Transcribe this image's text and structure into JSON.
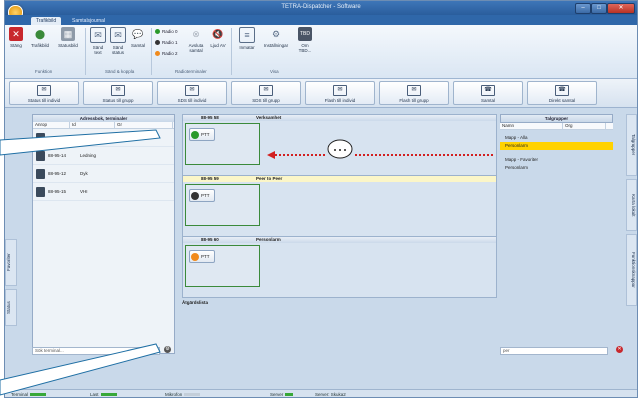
{
  "window": {
    "title": "TETRA-Dispatcher - Software"
  },
  "tabs": [
    "Trafikbild",
    "Samtalsjournal"
  ],
  "ribbon": {
    "buttons": [
      {
        "label": "Stäng",
        "icon": "close-icon",
        "color": "#c8282d"
      },
      {
        "label": "Trafikbild",
        "icon": "traffic-icon",
        "color": "#3a8a3a"
      },
      {
        "label": "Statusbild",
        "icon": "status-icon",
        "color": "#667788"
      },
      {
        "label": "Sänd text",
        "icon": "send-text-icon",
        "color": "#5a6e88"
      },
      {
        "label": "Sänd status",
        "icon": "send-status-icon",
        "color": "#5a6e88"
      },
      {
        "label": "Samtal",
        "icon": "call-bubble-icon",
        "color": "#5a6e88"
      }
    ],
    "radios": [
      {
        "label": "Radio 0",
        "color": "#2a9a2a"
      },
      {
        "label": "Radio 1",
        "color": "#333333"
      },
      {
        "label": "Radio 2",
        "color": "#f08a1c"
      }
    ],
    "radio_buttons": [
      {
        "label": "Avsluta samtal",
        "icon": "end-call-icon",
        "color": "#aab2bd"
      },
      {
        "label": "Ljud AV",
        "icon": "mute-icon",
        "color": "#5a6e88"
      }
    ],
    "view_buttons": [
      {
        "label": "Inmatar",
        "icon": "document-icon",
        "color": "#5a6e88"
      },
      {
        "label": "Inställningar",
        "icon": "settings-icon",
        "color": "#5a6e88"
      },
      {
        "label": "Om TBD...",
        "icon": "about-icon",
        "color": "#5a6e88"
      }
    ],
    "groups": [
      "Funktion",
      "Sänd & koppla",
      "Radioterminaler",
      "Visa"
    ]
  },
  "toolbar": [
    "Status till individ",
    "Status till grupp",
    "SDS till individ",
    "SDS till grupp",
    "Flash till individ",
    "Flash till grupp",
    "Samtal",
    "Direkt samtal"
  ],
  "left_tabs": [
    "Favoriter",
    "Status"
  ],
  "right_tabs": [
    "Talgrupper",
    "Karta lokalt",
    "Funktionsknappar"
  ],
  "address_book": {
    "title": "Adressbok, terminaler",
    "columns": [
      "Anrop",
      "Id",
      "Gr"
    ],
    "rows": [
      {
        "id": "",
        "gr": "BP"
      },
      {
        "id": "88-95-14",
        "gr": "Ledning"
      },
      {
        "id": "88-95-12",
        "gr": "Dyk"
      },
      {
        "id": "88-95-15",
        "gr": "VHI"
      }
    ],
    "search_placeholder": "Sök terminal..."
  },
  "groups": [
    {
      "id": "88-95 58",
      "title": "Verksamhet",
      "tag": "PTT",
      "color": "#2a9a2a",
      "yellow": false
    },
    {
      "id": "88-95 59",
      "title": "Peer to Peer",
      "tag": "PTT",
      "color": "#333333",
      "yellow": true
    },
    {
      "id": "88-95 60",
      "title": "Personlarm",
      "tag": "PTT",
      "color": "#f08a1c",
      "yellow": false
    }
  ],
  "activity_label": "Åtgärdslista",
  "talkgroups": {
    "title": "Talgrupper",
    "columns": [
      "Namn",
      "Org"
    ],
    "folder_all": "Mapp - Alla",
    "item_all": "Personlarm",
    "folder_fav": "Mapp - Favoriter",
    "item_fav": "Personlarm",
    "search_value": "per"
  },
  "statusbar": {
    "terminal": "Terminal",
    "last": "Last",
    "mic": "Mikrofon",
    "server": "Server",
    "server_status": "Server: Skuka2"
  }
}
